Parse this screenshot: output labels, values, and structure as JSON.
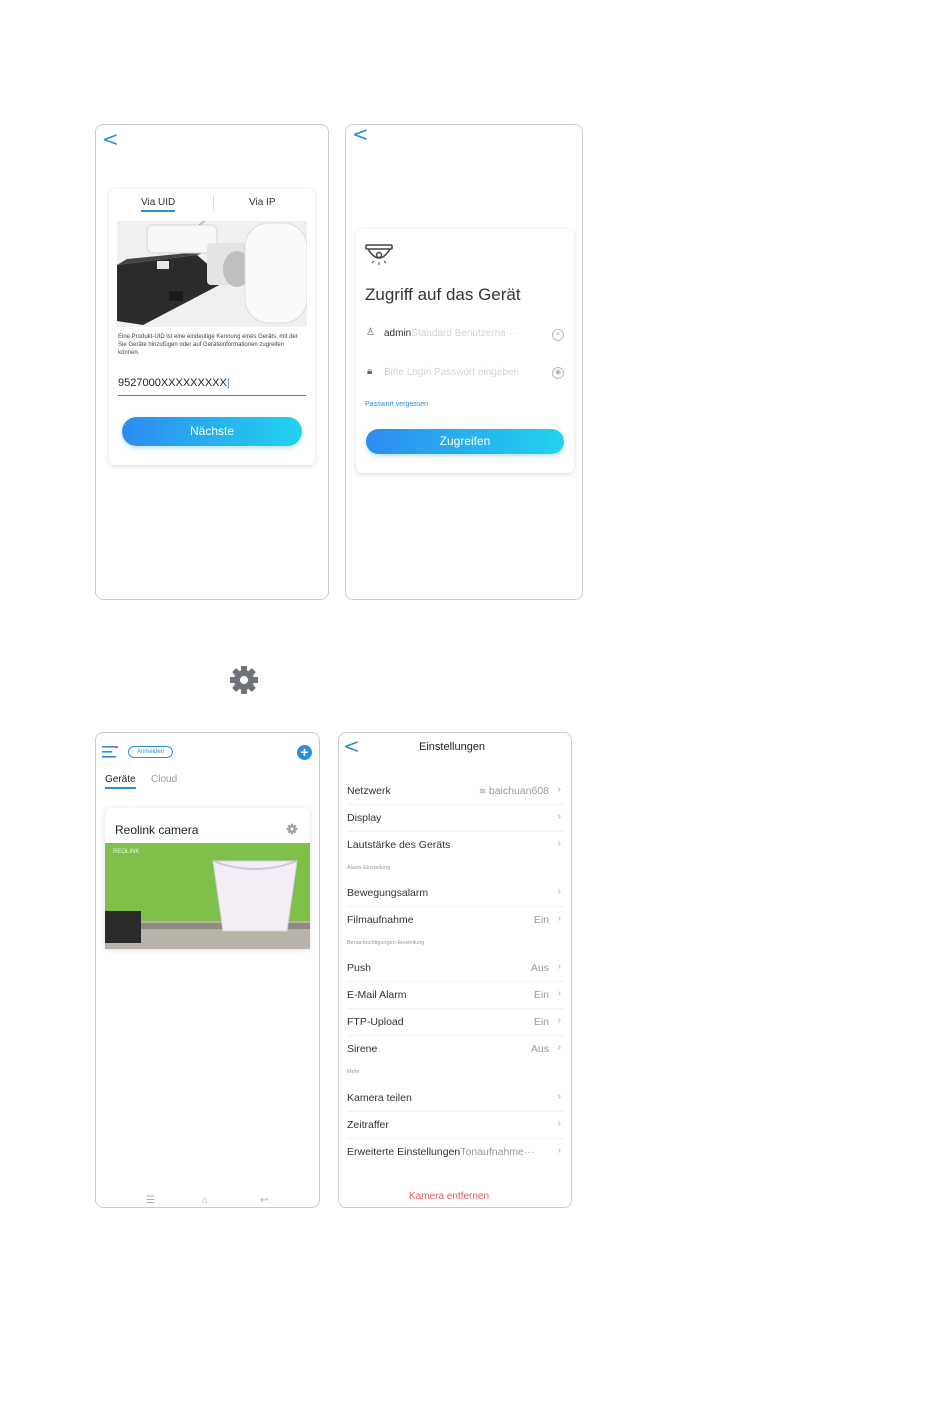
{
  "screen1": {
    "back": "<",
    "tab_uid": "Via UID",
    "tab_ip": "Via IP",
    "description": "Eine Produkt-UID ist eine eindeutige Kennung eines Geräts, mit der Sie Geräte hinzufügen oder auf Geräteinformationen zugreifen können.",
    "uid_value": "9527000XXXXXXXXX",
    "next_button": "Nächste"
  },
  "screen2": {
    "back": "<",
    "title": "Zugriff auf das Gerät",
    "username_value": "admin",
    "username_placeholder": "Standard Benutzerna···",
    "password_placeholder": "Bitte Login Passwort eingeben",
    "forgot_link": "Passwort vergessen",
    "access_button": "Zugreifen"
  },
  "gear_icon": "gear-icon",
  "screen3": {
    "signin": "Anmelden",
    "add": "+",
    "tab_devices": "Geräte",
    "tab_cloud": "Cloud",
    "camera_name": "Reolink camera",
    "thumb_brand": "REOLINK"
  },
  "screen4": {
    "back": "<",
    "title": "Einstellungen",
    "rows1": [
      {
        "label": "Netzwerk",
        "value": "baichuan608"
      },
      {
        "label": "Display",
        "value": ""
      },
      {
        "label": "Lautstärke des Geräts",
        "value": ""
      }
    ],
    "section_alarm": "Alarm-Einstellung",
    "rows2": [
      {
        "label": "Bewegungsalarm",
        "value": ""
      },
      {
        "label": "Filmaufnahme",
        "value": "Ein"
      }
    ],
    "section_notify": "Benachrichtigungen-Einstellung",
    "rows3": [
      {
        "label": "Push",
        "value": "Aus"
      },
      {
        "label": "E-Mail Alarm",
        "value": "Ein"
      },
      {
        "label": "FTP-Upload",
        "value": "Ein"
      },
      {
        "label": "Sirene",
        "value": "Aus"
      }
    ],
    "section_more": "Mehr",
    "rows4": [
      {
        "label": "Kamera teilen",
        "value": ""
      },
      {
        "label": "Zeitraffer",
        "value": ""
      },
      {
        "label": "Erweiterte Einstellungen",
        "value": "Tonaufnahme···"
      }
    ],
    "remove": "Kamera entfernen"
  },
  "colors": {
    "accent": "#2a8fd8",
    "gradient_start": "#2d8cf0",
    "gradient_end": "#22d3ee",
    "danger": "#e45b5b"
  }
}
